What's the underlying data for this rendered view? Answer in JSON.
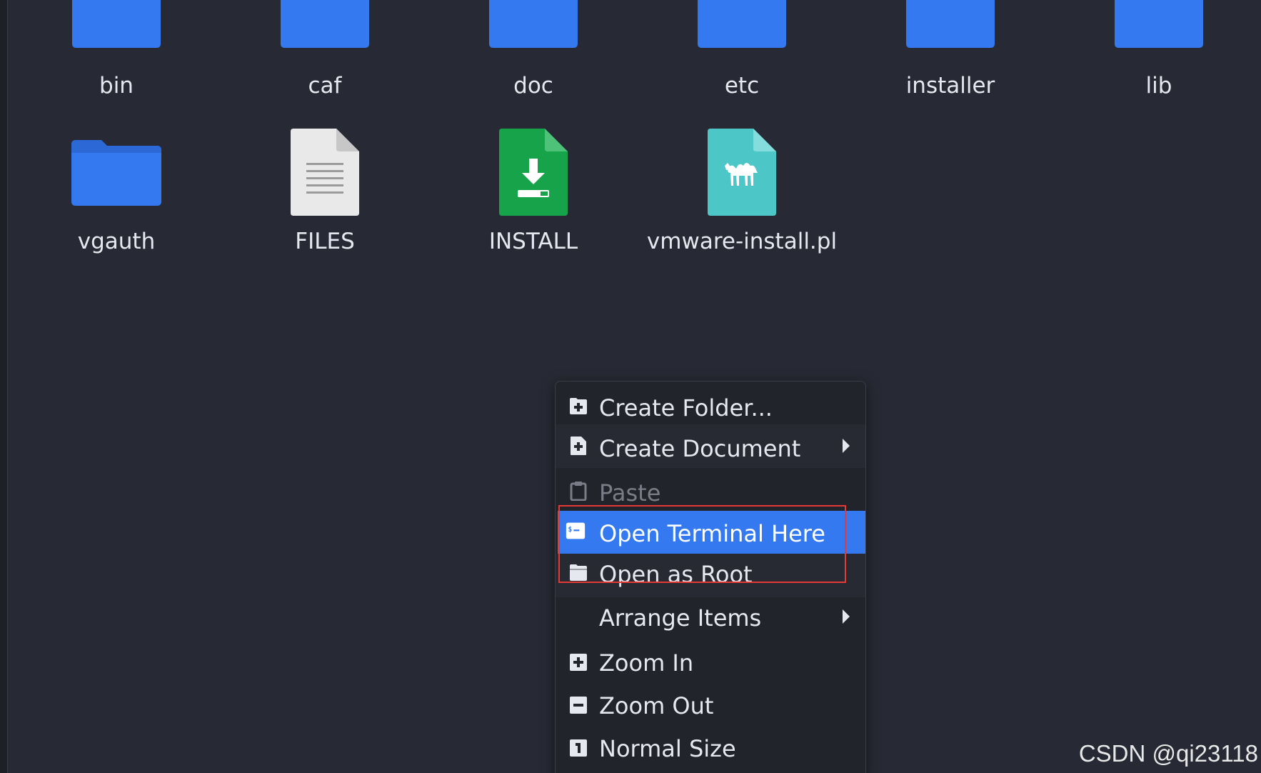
{
  "files": [
    {
      "label": "bin",
      "icon": "folder-icon"
    },
    {
      "label": "caf",
      "icon": "folder-icon"
    },
    {
      "label": "doc",
      "icon": "folder-icon"
    },
    {
      "label": "etc",
      "icon": "folder-icon"
    },
    {
      "label": "installer",
      "icon": "folder-icon"
    },
    {
      "label": "lib",
      "icon": "folder-icon"
    },
    {
      "label": "vgauth",
      "icon": "folder-icon"
    },
    {
      "label": "FILES",
      "icon": "text-file-icon"
    },
    {
      "label": "INSTALL",
      "icon": "install-package-icon"
    },
    {
      "label": "vmware-install.pl",
      "icon": "perl-script-icon"
    }
  ],
  "context_menu": {
    "items": [
      {
        "label": "Create Folder...",
        "icon": "folder-add-icon",
        "submenu": false,
        "enabled": true
      },
      {
        "label": "Create Document",
        "icon": "document-add-icon",
        "submenu": true,
        "enabled": true
      },
      {
        "label": "Paste",
        "icon": "clipboard-icon",
        "submenu": false,
        "enabled": false
      },
      {
        "label": "Open Terminal Here",
        "icon": "terminal-icon",
        "submenu": false,
        "enabled": true,
        "highlighted": true
      },
      {
        "label": "Open as Root",
        "icon": "folder-root-icon",
        "submenu": false,
        "enabled": true
      },
      {
        "label": "Arrange Items",
        "icon": "",
        "submenu": true,
        "enabled": true
      },
      {
        "label": "Zoom In",
        "icon": "zoom-in-icon",
        "submenu": false,
        "enabled": true
      },
      {
        "label": "Zoom Out",
        "icon": "zoom-out-icon",
        "submenu": false,
        "enabled": true
      },
      {
        "label": "Normal Size",
        "icon": "normal-size-icon",
        "submenu": false,
        "enabled": true
      }
    ]
  },
  "watermark": "CSDN @qi23118",
  "colors": {
    "background": "#272a34",
    "folder_blue": "#3479f0",
    "menu_background": "#22242c",
    "menu_highlight": "#3479f0",
    "annotation_red": "#e53935",
    "install_green": "#17a34a",
    "perl_teal": "#4cc6c6"
  }
}
